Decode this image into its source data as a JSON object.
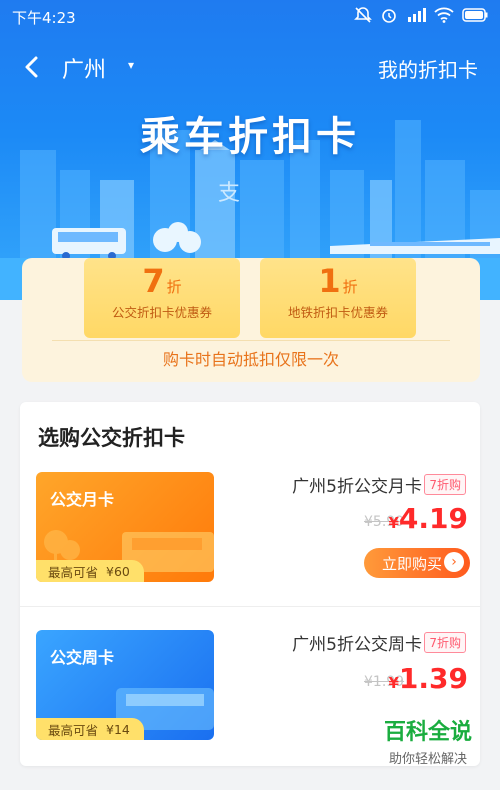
{
  "status_bar": {
    "time": "下午4:23"
  },
  "nav": {
    "city": "广州",
    "city_caret": "▾",
    "my_cards": "我的折扣卡"
  },
  "hero": {
    "title": "乘车折扣卡"
  },
  "coupons": [
    {
      "value": "7",
      "unit": "折",
      "desc": "公交折扣卡优惠券"
    },
    {
      "value": "1",
      "unit": "折",
      "desc": "地铁折扣卡优惠券"
    }
  ],
  "coupon_note": "购卡时自动抵扣仅限一次",
  "section": {
    "title": "选购公交折扣卡"
  },
  "products": [
    {
      "card_name": "公交月卡",
      "card_save_label": "最高可省",
      "card_save_value": "¥60",
      "name": "广州5折公交月卡",
      "tag": "7折购",
      "old_price": "¥5.99",
      "currency": "¥",
      "price": "4.19",
      "buy_label": "立即购买",
      "buy_chevron": "›"
    },
    {
      "card_name": "公交周卡",
      "card_save_label": "最高可省",
      "card_save_value": "¥14",
      "name": "广州5折公交周卡",
      "tag": "7折购",
      "old_price": "¥1.99",
      "currency": "¥",
      "price": "1.39"
    }
  ],
  "watermark": {
    "title": "百科全说",
    "subtitle": "助你轻松解决"
  },
  "colors": {
    "brand_blue": "#1f7bf0",
    "price_red": "#ff2a2a",
    "accent_orange": "#ff6a26"
  }
}
